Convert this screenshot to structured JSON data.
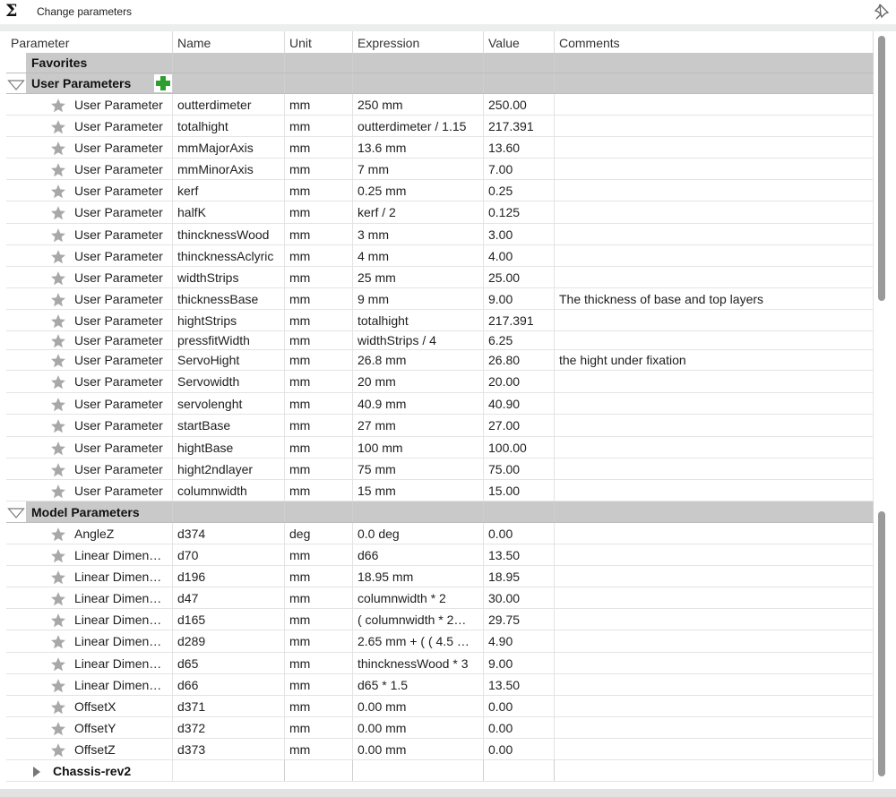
{
  "window": {
    "title": "Change parameters",
    "sigma": "Σ"
  },
  "columns": [
    "Parameter",
    "Name",
    "Unit",
    "Expression",
    "Value",
    "Comments"
  ],
  "favorites": {
    "label": "Favorites"
  },
  "user_params": {
    "label": "User Parameters",
    "rows": [
      {
        "param": "User Parameter",
        "name": "outterdimeter",
        "unit": "mm",
        "expr": "250 mm",
        "value": "250.00",
        "comment": ""
      },
      {
        "param": "User Parameter",
        "name": "totalhight",
        "unit": "mm",
        "expr": "outterdimeter / 1.15",
        "value": "217.391",
        "comment": ""
      },
      {
        "param": "User Parameter",
        "name": "mmMajorAxis",
        "unit": "mm",
        "expr": "13.6 mm",
        "value": "13.60",
        "comment": ""
      },
      {
        "param": "User Parameter",
        "name": "mmMinorAxis",
        "unit": "mm",
        "expr": "7 mm",
        "value": "7.00",
        "comment": ""
      },
      {
        "param": "User Parameter",
        "name": "kerf",
        "unit": "mm",
        "expr": "0.25 mm",
        "value": "0.25",
        "comment": ""
      },
      {
        "param": "User Parameter",
        "name": "halfK",
        "unit": "mm",
        "expr": "kerf / 2",
        "value": "0.125",
        "comment": ""
      },
      {
        "param": "User Parameter",
        "name": "thincknessWood",
        "unit": "mm",
        "expr": "3 mm",
        "value": "3.00",
        "comment": ""
      },
      {
        "param": "User Parameter",
        "name": "thincknessAclyric",
        "unit": "mm",
        "expr": "4 mm",
        "value": "4.00",
        "comment": ""
      },
      {
        "param": "User Parameter",
        "name": "widthStrips",
        "unit": "mm",
        "expr": "25 mm",
        "value": "25.00",
        "comment": ""
      },
      {
        "param": "User Parameter",
        "name": "thicknessBase",
        "unit": "mm",
        "expr": "9 mm",
        "value": "9.00",
        "comment": "The thickness of base and top layers"
      },
      {
        "param": "User Parameter",
        "name": "hightStrips",
        "unit": "mm",
        "expr": "totalhight",
        "value": "217.391",
        "comment": ""
      },
      {
        "param": "User Parameter",
        "name": "pressfitWidth",
        "unit": "mm",
        "expr": "widthStrips / 4",
        "value": "6.25",
        "comment": ""
      },
      {
        "param": "User Parameter",
        "name": "ServoHight",
        "unit": "mm",
        "expr": "26.8 mm",
        "value": "26.80",
        "comment": "the hight under fixation"
      },
      {
        "param": "User Parameter",
        "name": "Servowidth",
        "unit": "mm",
        "expr": "20 mm",
        "value": "20.00",
        "comment": ""
      },
      {
        "param": "User Parameter",
        "name": "servolenght",
        "unit": "mm",
        "expr": "40.9 mm",
        "value": "40.90",
        "comment": ""
      },
      {
        "param": "User Parameter",
        "name": "startBase",
        "unit": "mm",
        "expr": "27 mm",
        "value": "27.00",
        "comment": ""
      },
      {
        "param": "User Parameter",
        "name": "hightBase",
        "unit": "mm",
        "expr": "100 mm",
        "value": "100.00",
        "comment": ""
      },
      {
        "param": "User Parameter",
        "name": "hight2ndlayer",
        "unit": "mm",
        "expr": "75 mm",
        "value": "75.00",
        "comment": ""
      },
      {
        "param": "User Parameter",
        "name": "columnwidth",
        "unit": "mm",
        "expr": "15 mm",
        "value": "15.00",
        "comment": ""
      }
    ]
  },
  "model_params": {
    "label": "Model Parameters",
    "rows": [
      {
        "param": "AngleZ",
        "name": "d374",
        "unit": "deg",
        "expr": "0.0 deg",
        "value": "0.00",
        "comment": ""
      },
      {
        "param": "Linear Dimen…",
        "name": "d70",
        "unit": "mm",
        "expr": "d66",
        "value": "13.50",
        "comment": ""
      },
      {
        "param": "Linear Dimen…",
        "name": "d196",
        "unit": "mm",
        "expr": "18.95 mm",
        "value": "18.95",
        "comment": ""
      },
      {
        "param": "Linear Dimen…",
        "name": "d47",
        "unit": "mm",
        "expr": "columnwidth * 2",
        "value": "30.00",
        "comment": ""
      },
      {
        "param": "Linear Dimen…",
        "name": "d165",
        "unit": "mm",
        "expr": "( columnwidth * 2…",
        "value": "29.75",
        "comment": ""
      },
      {
        "param": "Linear Dimen…",
        "name": "d289",
        "unit": "mm",
        "expr": "2.65 mm + ( ( 4.5 …",
        "value": "4.90",
        "comment": ""
      },
      {
        "param": "Linear Dimen…",
        "name": "d65",
        "unit": "mm",
        "expr": "thincknessWood * 3",
        "value": "9.00",
        "comment": ""
      },
      {
        "param": "Linear Dimen…",
        "name": "d66",
        "unit": "mm",
        "expr": "d65 * 1.5",
        "value": "13.50",
        "comment": ""
      },
      {
        "param": "OffsetX",
        "name": "d371",
        "unit": "mm",
        "expr": "0.00 mm",
        "value": "0.00",
        "comment": ""
      },
      {
        "param": "OffsetY",
        "name": "d372",
        "unit": "mm",
        "expr": "0.00 mm",
        "value": "0.00",
        "comment": ""
      },
      {
        "param": "OffsetZ",
        "name": "d373",
        "unit": "mm",
        "expr": "0.00 mm",
        "value": "0.00",
        "comment": ""
      }
    ]
  },
  "component": {
    "label": "Chassis-rev2"
  },
  "icons": {
    "favorite": "star-icon",
    "add": "plus-icon",
    "pin": "pin-icon",
    "expand": "triangle-down-icon",
    "collapsed": "triangle-right-icon"
  },
  "colors": {
    "group_bg": "#c9c9c9",
    "add_green": "#2e9e2e",
    "star": "#a8a8a8"
  }
}
